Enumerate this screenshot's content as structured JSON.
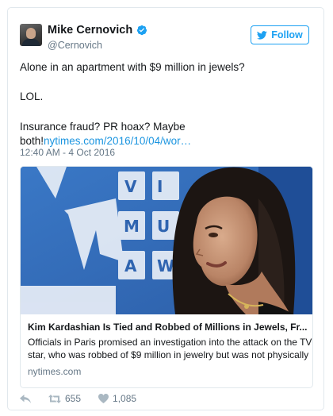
{
  "author": {
    "display_name": "Mike Cernovich",
    "handle": "@Cernovich",
    "verified": true,
    "avatar_icon": "profile-photo"
  },
  "follow_button": {
    "label": "Follow",
    "icon": "twitter-bird-icon",
    "color": "#1da1f2"
  },
  "tweet": {
    "line1": "Alone in an apartment with $9 million in jewels?",
    "line2": "LOL.",
    "line3": "Insurance fraud? PR hoax? Maybe",
    "line4_text": "both!",
    "line4_link": "nytimes.com/2016/10/04/wor…",
    "link_color": "#1b95e0",
    "timestamp": "12:40 AM - 4 Oct 2016"
  },
  "card": {
    "image_subject": "kim-kardashian-mtv-vma-backdrop",
    "title": "Kim Kardashian Is Tied and Robbed of Millions in Jewels, Fr...",
    "description_line1": "Officials in Paris promised an investigation into the attack on the TV",
    "description_line2": "star, who was robbed of $9 million in jewelry but was not physically",
    "domain": "nytimes.com"
  },
  "actions": {
    "reply_icon": "reply-icon",
    "retweet_icon": "retweet-icon",
    "retweet_count": "655",
    "like_icon": "heart-icon",
    "like_count": "1,085"
  }
}
